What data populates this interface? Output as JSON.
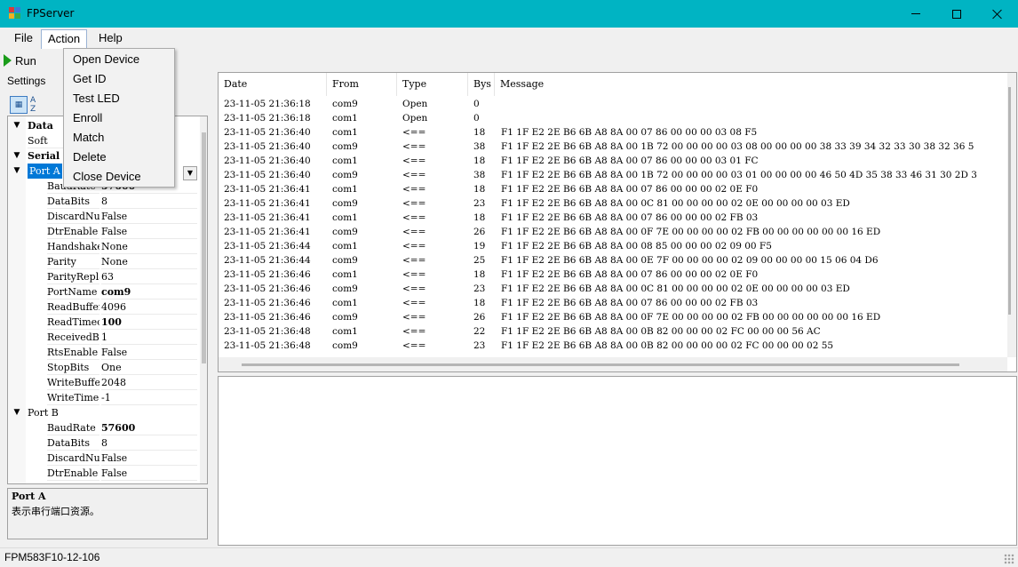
{
  "window": {
    "title": "FPServer"
  },
  "menubar": {
    "items": [
      "File",
      "Action",
      "Help"
    ]
  },
  "toolbar": {
    "run_label": "Run"
  },
  "settings": {
    "label": "Settings"
  },
  "action_menu": {
    "items": [
      "Open Device",
      "Get ID",
      "Test LED",
      "Enroll",
      "Match",
      "Delete",
      "Close Device"
    ]
  },
  "property_grid": {
    "categories": {
      "data": "Data",
      "data_child": "Soft",
      "serial": "Serial",
      "port_a": "Port A",
      "port_b": "Port B"
    },
    "port_a_props": [
      {
        "name": "BaudRate",
        "value": "57600",
        "bold": true
      },
      {
        "name": "DataBits",
        "value": "8"
      },
      {
        "name": "DiscardNull",
        "value": "False"
      },
      {
        "name": "DtrEnable",
        "value": "False"
      },
      {
        "name": "Handshake",
        "value": "None"
      },
      {
        "name": "Parity",
        "value": "None"
      },
      {
        "name": "ParityReplace",
        "value": "63"
      },
      {
        "name": "PortName",
        "value": "com9",
        "bold": true
      },
      {
        "name": "ReadBufferSize",
        "value": "4096"
      },
      {
        "name": "ReadTimeout",
        "value": "100",
        "bold": true
      },
      {
        "name": "ReceivedBytesThreshold",
        "value": "1"
      },
      {
        "name": "RtsEnable",
        "value": "False"
      },
      {
        "name": "StopBits",
        "value": "One"
      },
      {
        "name": "WriteBufferSize",
        "value": "2048"
      },
      {
        "name": "WriteTimeout",
        "value": "-1"
      }
    ],
    "port_b_props": [
      {
        "name": "BaudRate",
        "value": "57600",
        "bold": true
      },
      {
        "name": "DataBits",
        "value": "8"
      },
      {
        "name": "DiscardNull",
        "value": "False"
      },
      {
        "name": "DtrEnable",
        "value": "False"
      }
    ],
    "help_title": "Port A",
    "help_desc": "表示串行端口资源。"
  },
  "log": {
    "columns": [
      "Date",
      "From",
      "Type",
      "Bys",
      "Message"
    ],
    "rows": [
      [
        "23-11-05 21:36:18",
        "com9",
        "Open",
        "0",
        ""
      ],
      [
        "23-11-05 21:36:18",
        "com1",
        "Open",
        "0",
        ""
      ],
      [
        "23-11-05 21:36:40",
        "com1",
        "<==",
        "18",
        "F1 1F E2 2E B6 6B A8 8A 00 07 86 00 00 00 03 08 F5"
      ],
      [
        "23-11-05 21:36:40",
        "com9",
        "<==",
        "38",
        "F1 1F E2 2E B6 6B A8 8A 00 1B 72 00 00 00 00 03 08 00 00 00 00 38 33 39 34 32 33 30 38 32 36 5"
      ],
      [
        "23-11-05 21:36:40",
        "com1",
        "<==",
        "18",
        "F1 1F E2 2E B6 6B A8 8A 00 07 86 00 00 00 03 01 FC"
      ],
      [
        "23-11-05 21:36:40",
        "com9",
        "<==",
        "38",
        "F1 1F E2 2E B6 6B A8 8A 00 1B 72 00 00 00 00 03 01 00 00 00 00 46 50 4D 35 38 33 46 31 30 2D 3"
      ],
      [
        "23-11-05 21:36:41",
        "com1",
        "<==",
        "18",
        "F1 1F E2 2E B6 6B A8 8A 00 07 86 00 00 00 02 0E F0"
      ],
      [
        "23-11-05 21:36:41",
        "com9",
        "<==",
        "23",
        "F1 1F E2 2E B6 6B A8 8A 00 0C 81 00 00 00 00 02 0E 00 00 00 00 03 ED"
      ],
      [
        "23-11-05 21:36:41",
        "com1",
        "<==",
        "18",
        "F1 1F E2 2E B6 6B A8 8A 00 07 86 00 00 00 02 FB 03"
      ],
      [
        "23-11-05 21:36:41",
        "com9",
        "<==",
        "26",
        "F1 1F E2 2E B6 6B A8 8A 00 0F 7E 00 00 00 00 02 FB 00 00 00 00 00 00 16 ED"
      ],
      [
        "23-11-05 21:36:44",
        "com1",
        "<==",
        "19",
        "F1 1F E2 2E B6 6B A8 8A 00 08 85 00 00 00 02 09 00 F5"
      ],
      [
        "23-11-05 21:36:44",
        "com9",
        "<==",
        "25",
        "F1 1F E2 2E B6 6B A8 8A 00 0E 7F 00 00 00 00 02 09 00 00 00 00 15 06 04 D6"
      ],
      [
        "23-11-05 21:36:46",
        "com1",
        "<==",
        "18",
        "F1 1F E2 2E B6 6B A8 8A 00 07 86 00 00 00 02 0E F0"
      ],
      [
        "23-11-05 21:36:46",
        "com9",
        "<==",
        "23",
        "F1 1F E2 2E B6 6B A8 8A 00 0C 81 00 00 00 00 02 0E 00 00 00 00 03 ED"
      ],
      [
        "23-11-05 21:36:46",
        "com1",
        "<==",
        "18",
        "F1 1F E2 2E B6 6B A8 8A 00 07 86 00 00 00 02 FB 03"
      ],
      [
        "23-11-05 21:36:46",
        "com9",
        "<==",
        "26",
        "F1 1F E2 2E B6 6B A8 8A 00 0F 7E 00 00 00 00 02 FB 00 00 00 00 00 00 16 ED"
      ],
      [
        "23-11-05 21:36:48",
        "com1",
        "<==",
        "22",
        "F1 1F E2 2E B6 6B A8 8A 00 0B 82 00 00 00 02 FC 00 00 00 56 AC"
      ],
      [
        "23-11-05 21:36:48",
        "com9",
        "<==",
        "23",
        "F1 1F E2 2E B6 6B A8 8A 00 0B 82 00 00 00 00 02 FC 00 00 00 02 55"
      ]
    ]
  },
  "statusbar": {
    "text": "FPM583F10-12-106"
  },
  "colors": {
    "titlebar": "#00b4c3",
    "selection": "#0078d7",
    "run_icon": "#1a9c1a"
  }
}
